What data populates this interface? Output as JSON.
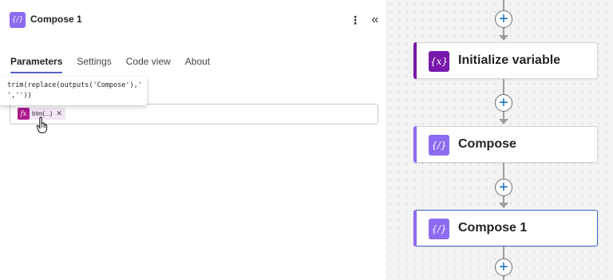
{
  "panel": {
    "title": "Compose 1",
    "icon": "compose-icon",
    "more_glyph": "⋮",
    "collapse_glyph": "«",
    "tabs": [
      {
        "label": "Parameters",
        "active": true
      },
      {
        "label": "Settings",
        "active": false
      },
      {
        "label": "Code view",
        "active": false
      },
      {
        "label": "About",
        "active": false
      }
    ],
    "tooltip": "trim(replace(outputs('Compose'),' ',''))",
    "token": {
      "icon_text": "fx",
      "label": "trim(...)",
      "close": "✕"
    }
  },
  "canvas": {
    "add_glyph": "+",
    "cards": [
      {
        "title": "Initialize variable",
        "icon_text": "{x}",
        "icon": "variable-icon",
        "color": "#7719aa"
      },
      {
        "title": "Compose",
        "icon_text": "{⁄}",
        "icon": "compose-icon",
        "color": "#8b6cf0"
      },
      {
        "title": "Compose 1",
        "icon_text": "{⁄}",
        "icon": "compose-icon",
        "color": "#8b6cf0",
        "selected": true
      }
    ]
  },
  "colors": {
    "compose": "#8b6cf0",
    "variable": "#7719aa",
    "expression": "#ab1b8d",
    "selection": "#3a5fc4",
    "add": "#0f6cbd"
  }
}
